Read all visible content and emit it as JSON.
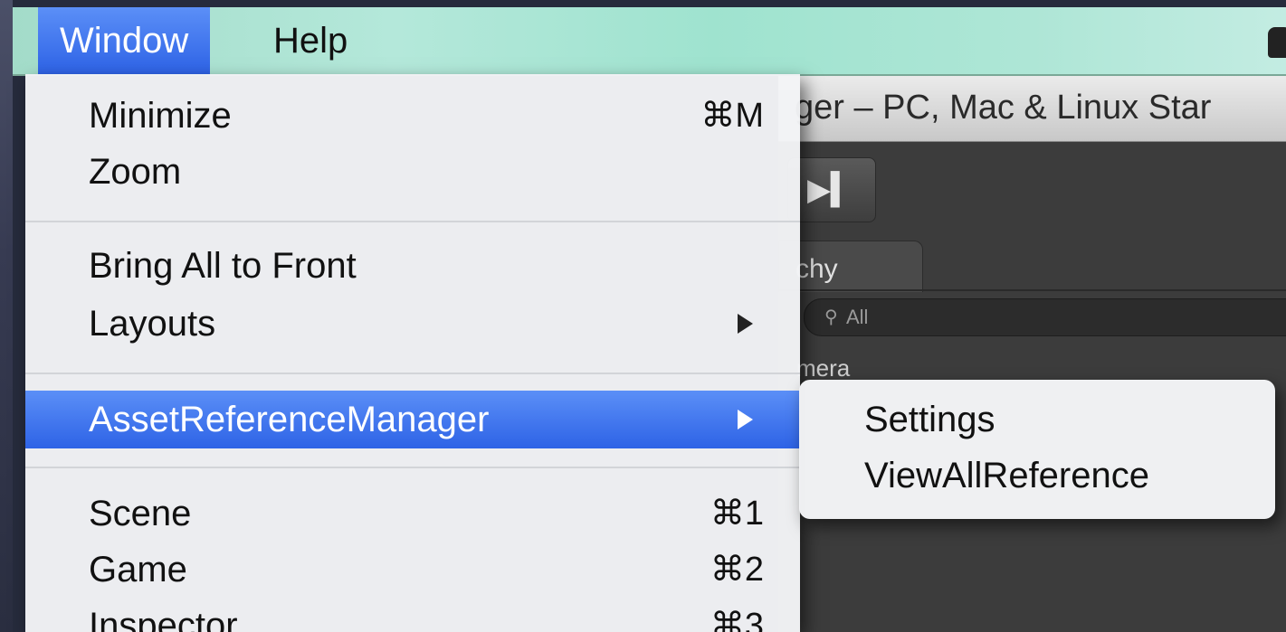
{
  "menubar": {
    "items": [
      {
        "label": "Window"
      },
      {
        "label": "Help"
      }
    ]
  },
  "background_window": {
    "title": "ger – PC, Mac & Linux Star",
    "tab_label": "chy",
    "search_placeholder": "All",
    "hierarchy_item": "mera"
  },
  "window_menu": {
    "items": [
      {
        "label": "Minimize",
        "shortcut": "⌘M"
      },
      {
        "label": "Zoom",
        "shortcut": ""
      },
      {
        "label": "Bring All to Front",
        "shortcut": ""
      },
      {
        "label": "Layouts",
        "shortcut": ""
      },
      {
        "label": "AssetReferenceManager",
        "shortcut": ""
      },
      {
        "label": "Scene",
        "shortcut": "⌘1"
      },
      {
        "label": "Game",
        "shortcut": "⌘2"
      },
      {
        "label": "Inspector",
        "shortcut": "⌘3"
      }
    ]
  },
  "submenu": {
    "items": [
      {
        "label": "Settings"
      },
      {
        "label": "ViewAllReference"
      }
    ]
  },
  "colors": {
    "highlight": "#3a70ee",
    "menubar": "#a9e2d1",
    "unity_bg": "#3c3c3c"
  }
}
